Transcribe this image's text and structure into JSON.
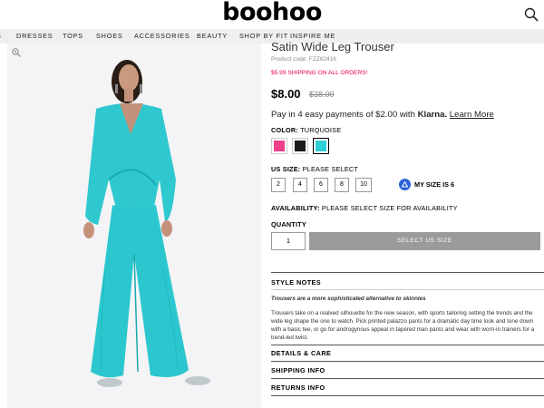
{
  "header": {
    "logo": "boohoo",
    "search_icon": "search-icon"
  },
  "nav": {
    "items": [
      "S",
      "DRESSES",
      "TOPS",
      "SHOES",
      "ACCESSORIES",
      "BEAUTY",
      "SHOP BY FIT",
      "INSPIRE ME"
    ]
  },
  "product": {
    "title": "Satin Wide Leg Trouser",
    "code": "Product code: FZZ82416",
    "promo": "$5.99 SHIPPING ON ALL ORDERS!",
    "price": "$8.00",
    "old_price": "$38.00",
    "klarna_text": "Pay in 4 easy payments of $2.00 with",
    "klarna_brand": "Klarna.",
    "klarna_link": "Learn More",
    "zoom_icon": "zoom-icon"
  },
  "color": {
    "label": "COLOR:",
    "value": "TURQUOISE",
    "swatches": [
      {
        "name": "pink",
        "hex": "#ef3e8a"
      },
      {
        "name": "black",
        "hex": "#1c1c1c"
      },
      {
        "name": "turquoise",
        "hex": "#2ecfd6"
      }
    ]
  },
  "size": {
    "label": "US SIZE:",
    "value": "PLEASE SELECT",
    "options": [
      "2",
      "4",
      "6",
      "8",
      "10"
    ],
    "my_size": "MY SIZE IS 6"
  },
  "availability": {
    "label": "AVAILABILITY:",
    "value": "PLEASE SELECT SIZE FOR AVAILABILITY"
  },
  "quantity": {
    "label": "QUANTITY",
    "value": "1",
    "button": "SELECT US SIZE"
  },
  "style_notes": {
    "title": "STYLE NOTES",
    "lead": "Trousers are a more sophisticated alternative to skinnies",
    "body": "Trousers take on a realxed silhouette for the new season, with sports tailoring setting the trends and the wide leg shape the one to watch. Pick printed palazzo pants for a dramatic day time look and tone down with a basic tee, or go for androgynous appeal in tapered man pants and wear with worn-in trainers for a trend-led twist."
  },
  "sections": {
    "details": "DETAILS & CARE",
    "shipping": "SHIPPING INFO",
    "returns": "RETURNS INFO"
  },
  "colors": {
    "promo_red": "#e5003b",
    "nav_bg": "#efefef",
    "button_grey": "#9b9b9b",
    "garment": "#2ecfd6"
  }
}
